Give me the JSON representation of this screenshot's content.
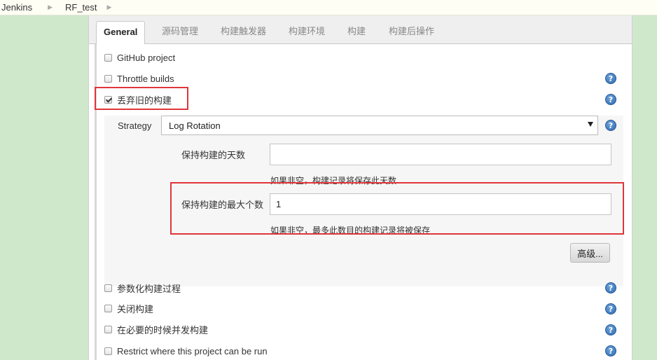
{
  "breadcrumb": {
    "items": [
      "Jenkins",
      "RF_test"
    ]
  },
  "tabs": [
    "General",
    "源码管理",
    "构建触发器",
    "构建环境",
    "构建",
    "构建后操作"
  ],
  "options": {
    "github_project": "GitHub project",
    "throttle_builds": "Throttle builds",
    "discard_old_builds": "丢弃旧的构建",
    "parameterized": "参数化构建过程",
    "disable_build": "关闭构建",
    "concurrent_builds": "在必要的时候并发构建",
    "restrict_where": "Restrict where this project can be run"
  },
  "discard": {
    "strategy_label": "Strategy",
    "strategy_value": "Log Rotation",
    "days_label": "保持构建的天数",
    "days_value": "",
    "days_hint": "如果非空，构建记录将保存此天数",
    "max_label": "保持构建的最大个数",
    "max_value": "1",
    "max_hint": "如果非空，最多此数目的构建记录将被保存",
    "advanced_button": "高级..."
  },
  "help_icon_text": "?",
  "colors": {
    "background": "#cfe8cc",
    "highlight": "#e0363a",
    "help_icon": "#2d6bb1"
  }
}
